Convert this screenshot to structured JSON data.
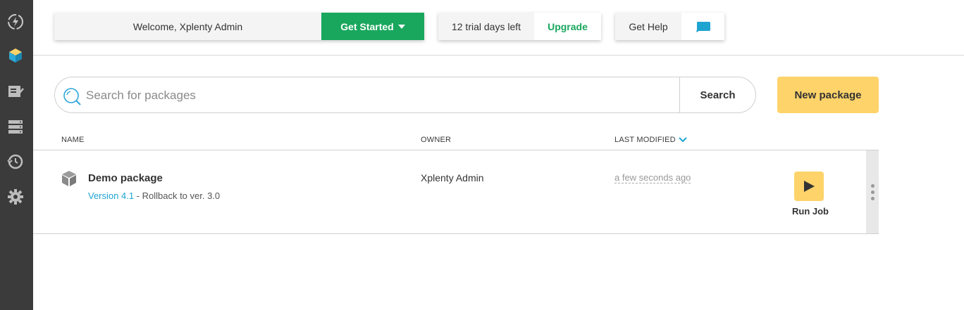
{
  "sidebar": {
    "items": [
      {
        "icon": "lightning-icon"
      },
      {
        "icon": "packages-icon",
        "active": true,
        "color": "#2fa8d8"
      },
      {
        "icon": "jobs-icon"
      },
      {
        "icon": "clusters-icon"
      },
      {
        "icon": "schedules-icon"
      },
      {
        "icon": "settings-icon"
      }
    ]
  },
  "topbar": {
    "welcome": "Welcome, Xplenty Admin",
    "get_started": "Get Started",
    "trial": "12 trial days left",
    "upgrade": "Upgrade",
    "help": "Get Help",
    "chat_icon": "chat-icon"
  },
  "search": {
    "placeholder": "Search for packages",
    "value": "",
    "button": "Search"
  },
  "new_package": "New package",
  "table": {
    "columns": [
      "NAME",
      "OWNER",
      "LAST MODIFIED"
    ],
    "sort_icon": "chevron-down-icon",
    "rows": [
      {
        "name": "Demo package",
        "version_link": "Version 4.1",
        "version_rest": " - Rollback to ver. 3.0",
        "owner": "Xplenty Admin",
        "modified": "a few seconds ago",
        "action": "Run Job"
      }
    ]
  },
  "colors": {
    "sidebar_bg": "#3b3b3b",
    "green": "#19a75d",
    "yellow": "#fdd36a",
    "link_blue": "#1ea4d1"
  }
}
